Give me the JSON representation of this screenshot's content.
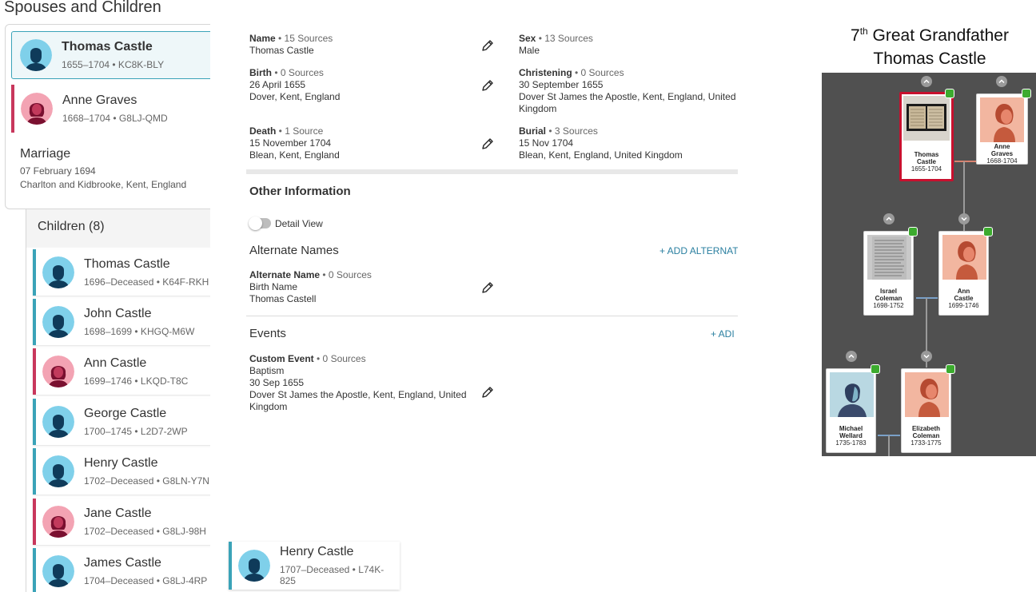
{
  "left": {
    "section_title": "Spouses and Children",
    "father": {
      "name": "Thomas Castle",
      "meta": "1655–1704 • KC8K-BLY"
    },
    "mother": {
      "name": "Anne Graves",
      "meta": "1668–1704 • G8LJ-QMD"
    },
    "marriage": {
      "title": "Marriage",
      "date": "07 February 1694",
      "place": "Charlton and Kidbrooke, Kent, England"
    },
    "children_header": "Children (8)",
    "children": [
      {
        "name": "Thomas Castle",
        "meta": "1696–Deceased • K64F-RKH",
        "sex": "male"
      },
      {
        "name": "John Castle",
        "meta": "1698–1699 • KHGQ-M6W",
        "sex": "male"
      },
      {
        "name": "Ann Castle",
        "meta": "1699–1746 • LKQD-T8C",
        "sex": "female"
      },
      {
        "name": "George Castle",
        "meta": "1700–1745 • L2D7-2WP",
        "sex": "male"
      },
      {
        "name": "Henry Castle",
        "meta": "1702–Deceased • G8LN-Y7N",
        "sex": "male"
      },
      {
        "name": "Jane Castle",
        "meta": "1702–Deceased • G8LJ-98H",
        "sex": "female"
      },
      {
        "name": "James Castle",
        "meta": "1704–Deceased • G8LJ-4RP",
        "sex": "male"
      }
    ],
    "floating_child": {
      "name": "Henry Castle",
      "meta": "1707–Deceased • L74K-825"
    }
  },
  "vitals": {
    "name": {
      "label": "Name",
      "sources": " • 15 Sources",
      "value": "Thomas Castle"
    },
    "sex": {
      "label": "Sex",
      "sources": " • 13 Sources",
      "value": "Male"
    },
    "birth": {
      "label": "Birth",
      "sources": " • 0 Sources",
      "date": "26 April 1655",
      "place": "Dover, Kent, England"
    },
    "christening": {
      "label": "Christening",
      "sources": " • 0 Sources",
      "date": "30 September 1655",
      "place1": "Dover St James the Apostle, Kent, England, United",
      "place2": "Kingdom"
    },
    "death": {
      "label": "Death",
      "sources": " • 1 Source",
      "date": "15 November 1704",
      "place": "Blean, Kent, England"
    },
    "burial": {
      "label": "Burial",
      "sources": " • 3 Sources",
      "date": "15 Nov 1704",
      "place": "Blean, Kent, England, United Kingdom"
    }
  },
  "other": {
    "title": "Other Information",
    "detail_view": "Detail View",
    "alt_names_title": "Alternate Names",
    "add_alt": "+ ADD ALTERNAT",
    "alt_name": {
      "label": "Alternate Name",
      "sources": " • 0 Sources",
      "type": "Birth Name",
      "value": "Thomas Castell"
    },
    "events_title": "Events",
    "add_event": "+ ADI",
    "event": {
      "label": "Custom Event",
      "sources": " • 0 Sources",
      "type": "Baptism",
      "date": "30 Sep 1655",
      "place1": "Dover St James the Apostle, Kent, England, United",
      "place2": "Kingdom"
    }
  },
  "tree": {
    "title_prefix": "7",
    "title_sup": "th",
    "title_line1_rest": " Great Grandfather",
    "title_line2": "Thomas Castle",
    "people": [
      {
        "first": "Thomas",
        "last": "Castle",
        "dates": "1655-1704"
      },
      {
        "first": "Anne",
        "last": "Graves",
        "dates": "1668-1704"
      },
      {
        "first": "Israel",
        "last": "Coleman",
        "dates": "1698-1752"
      },
      {
        "first": "Ann",
        "last": "Castle",
        "dates": "1699-1746"
      },
      {
        "first": "Michael",
        "last": "Wellard",
        "dates": "1735-1783"
      },
      {
        "first": "Elizabeth",
        "last": "Coleman",
        "dates": "1733-1775"
      }
    ]
  },
  "colors": {
    "male_accent": "#3aa3b8",
    "female_accent": "#c8375c",
    "selected": "#c8102e",
    "link": "#2a7fa0"
  }
}
